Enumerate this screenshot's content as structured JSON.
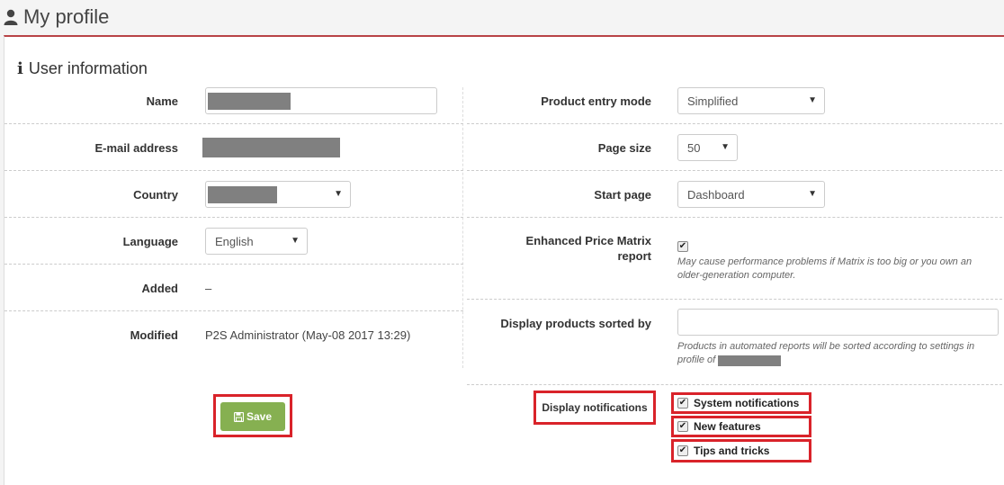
{
  "page": {
    "title": "My profile",
    "icon": "user-icon"
  },
  "section": {
    "title": "User information",
    "icon": "info-icon"
  },
  "left": {
    "name_label": "Name",
    "email_label": "E-mail address",
    "country_label": "Country",
    "language_label": "Language",
    "language_value": "English",
    "added_label": "Added",
    "added_value": "–",
    "modified_label": "Modified",
    "modified_value": "P2S Administrator (May-08 2017 13:29)"
  },
  "right": {
    "product_entry_label": "Product entry mode",
    "product_entry_value": "Simplified",
    "page_size_label": "Page size",
    "page_size_value": "50",
    "start_page_label": "Start page",
    "start_page_value": "Dashboard",
    "epm_label_line1": "Enhanced Price Matrix",
    "epm_label_line2": "report",
    "epm_checked": true,
    "epm_hint_line1": "May cause performance problems if Matrix is too big or you own an",
    "epm_hint_line2": "older-generation computer.",
    "sorted_label": "Display products sorted by",
    "sorted_value": "",
    "sorted_hint_line1": "Products in automated reports will be sorted according to settings in",
    "sorted_hint_line2": "profile of"
  },
  "actions": {
    "save_label": "Save",
    "save_icon": "floppy-disk-icon"
  },
  "notifications": {
    "label": "Display notifications",
    "items": [
      {
        "label": "System notifications",
        "checked": true
      },
      {
        "label": "New features",
        "checked": true
      },
      {
        "label": "Tips and tricks",
        "checked": true
      }
    ]
  },
  "colors": {
    "accent": "#b84346",
    "save": "#86b051",
    "highlight": "#d9232a",
    "redaction": "#808080"
  }
}
